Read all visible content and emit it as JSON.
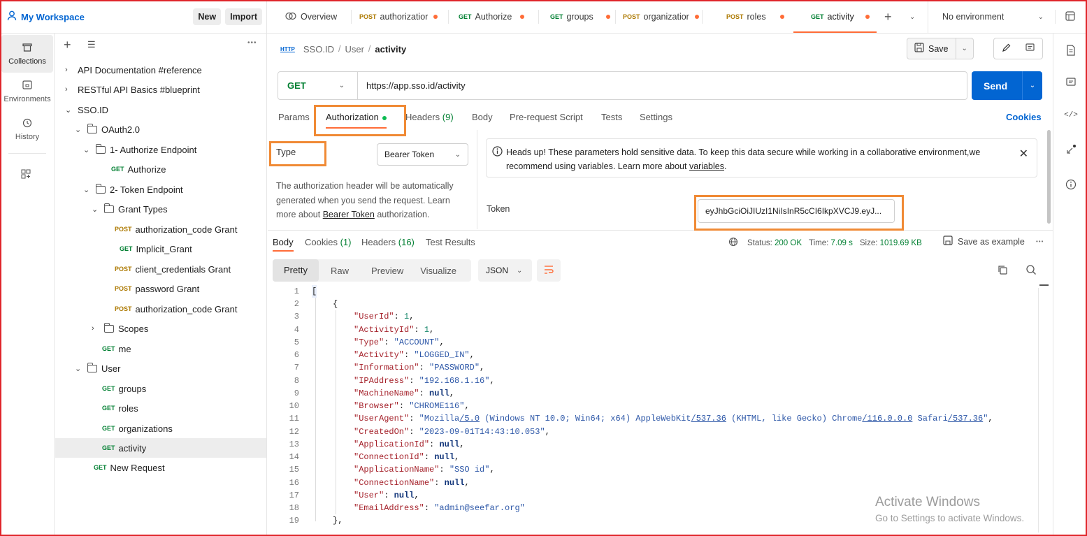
{
  "workspace": {
    "name": "My Workspace",
    "new_label": "New",
    "import_label": "Import"
  },
  "tabs": [
    {
      "method": "",
      "label": "Overview",
      "dot": false
    },
    {
      "method": "POST",
      "label": "authorizatior",
      "dot": true
    },
    {
      "method": "GET",
      "label": "Authorize",
      "dot": true
    },
    {
      "method": "GET",
      "label": "groups",
      "dot": true
    },
    {
      "method": "POST",
      "label": "organizatior",
      "dot": true
    },
    {
      "method": "POST",
      "label": "roles",
      "dot": true
    },
    {
      "method": "GET",
      "label": "activity",
      "dot": true
    }
  ],
  "environment": "No environment",
  "rail": {
    "collections": "Collections",
    "environments": "Environments",
    "history": "History"
  },
  "tree": {
    "items": [
      {
        "label": "API Documentation #reference"
      },
      {
        "label": "RESTful API Basics #blueprint"
      },
      {
        "label": "SSO.ID"
      },
      {
        "label": "OAuth2.0"
      },
      {
        "label": "1- Authorize Endpoint"
      },
      {
        "method": "GET",
        "label": "Authorize"
      },
      {
        "label": "2- Token Endpoint"
      },
      {
        "label": "Grant Types"
      },
      {
        "method": "POST",
        "label": "authorization_code Grant"
      },
      {
        "method": "GET",
        "label": "Implicit_Grant"
      },
      {
        "method": "POST",
        "label": "client_credentials Grant"
      },
      {
        "method": "POST",
        "label": "password Grant"
      },
      {
        "method": "POST",
        "label": "authorization_code Grant"
      },
      {
        "label": "Scopes"
      },
      {
        "method": "GET",
        "label": "me"
      },
      {
        "label": "User"
      },
      {
        "method": "GET",
        "label": "groups"
      },
      {
        "method": "GET",
        "label": "roles"
      },
      {
        "method": "GET",
        "label": "organizations"
      },
      {
        "method": "GET",
        "label": "activity"
      },
      {
        "method": "GET",
        "label": "New Request"
      }
    ]
  },
  "breadcrumb": {
    "b1": "SSO.ID",
    "b2": "User",
    "current": "activity"
  },
  "save_label": "Save",
  "request": {
    "method": "GET",
    "url": "https://app.sso.id/activity",
    "send": "Send"
  },
  "param_tabs": {
    "params": "Params",
    "authorization": "Authorization",
    "headers": "Headers",
    "headers_count": "(9)",
    "body": "Body",
    "prerequest": "Pre-request Script",
    "tests": "Tests",
    "settings": "Settings",
    "cookies": "Cookies"
  },
  "auth": {
    "type_label": "Type",
    "type_value": "Bearer Token",
    "desc_1": "The authorization header will be automatically generated when you send the request. Learn more about",
    "desc_link": "Bearer Token",
    "desc_2": "authorization.",
    "notice_1": "Heads up! These parameters hold sensitive data. To keep this data secure while working in a collaborative environment,we recommend using variables. Learn more about",
    "notice_link": "variables",
    "token_label": "Token",
    "token_value": "eyJhbGciOiJIUzI1NiIsInR5cCI6IkpXVCJ9.eyJ..."
  },
  "response": {
    "tabs": {
      "body": "Body",
      "cookies": "Cookies",
      "cookies_count": "(1)",
      "headers": "Headers",
      "headers_count": "(16)",
      "tests": "Test Results"
    },
    "status_label": "Status:",
    "status": "200 OK",
    "time_label": "Time:",
    "time": "7.09 s",
    "size_label": "Size:",
    "size": "1019.69 KB",
    "save_example": "Save as example",
    "views": {
      "pretty": "Pretty",
      "raw": "Raw",
      "preview": "Preview",
      "visualize": "Visualize",
      "format": "JSON"
    }
  },
  "code_lines": [
    "1",
    "2",
    "3",
    "4",
    "5",
    "6",
    "7",
    "8",
    "9",
    "10",
    "11",
    "12",
    "13",
    "14",
    "15",
    "16",
    "17",
    "18",
    "19"
  ],
  "json": {
    "UserId": "1",
    "ActivityId": "1",
    "Type": "\"ACCOUNT\"",
    "Activity": "\"LOGGED_IN\"",
    "Information": "\"PASSWORD\"",
    "IPAddress": "\"192.168.1.16\"",
    "MachineName": "null",
    "Browser": "\"CHROME116\"",
    "CreatedOn": "\"2023-09-01T14:43:10.053\"",
    "ApplicationId": "null",
    "ConnectionId": "null",
    "ApplicationName": "\"SSO id\"",
    "ConnectionName": "null",
    "User": "null",
    "EmailAddress": "\"admin@seefar.org\"",
    "ua_p1": "\"Mozilla",
    "ua_v1": "/5.0",
    "ua_p2": " (Windows NT 10.0; Win64; x64) AppleWebKit",
    "ua_v2": "/537.36",
    "ua_p3": " (KHTML, like Gecko) Chrome",
    "ua_v3": "/116.0.0.0",
    "ua_p4": " Safari",
    "ua_v4": "/537.36",
    "ua_p5": "\""
  },
  "watermark": {
    "title": "Activate Windows",
    "subtitle": "Go to Settings to activate Windows."
  },
  "colors": {
    "accent": "#0265d2",
    "highlight": "#f08a35",
    "get": "#007f31",
    "post": "#ad7a03",
    "dot": "#ff6c37"
  }
}
